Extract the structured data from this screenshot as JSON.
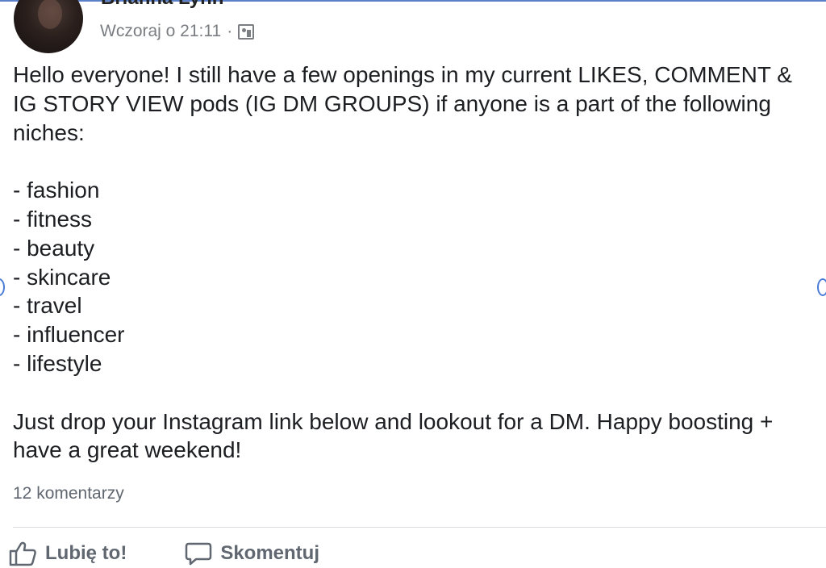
{
  "post": {
    "author": "Brianna Lynn",
    "timestamp": "Wczoraj o 21:11",
    "separator": "·",
    "audience_icon": "group-icon",
    "intro": "Hello everyone! I still have a few openings in my current LIKES, COMMENT & IG STORY VIEW pods (IG DM GROUPS) if anyone is a part of the following niches:",
    "niches": [
      "- fashion",
      "- fitness",
      "- beauty",
      "- skincare",
      "- travel",
      "- influencer",
      "- lifestyle"
    ],
    "outro": "Just drop your Instagram link below and lookout for a DM. Happy boosting + have a great weekend!"
  },
  "stats": {
    "comments": "12 komentarzy"
  },
  "actions": {
    "like_label": "Lubię to!",
    "like_icon": "thumbs-up-icon",
    "comment_label": "Skomentuj",
    "comment_icon": "comment-bubble-icon"
  },
  "colors": {
    "text": "#1c1e21",
    "secondary": "#606770",
    "selection_handle": "#4a7bd6"
  }
}
